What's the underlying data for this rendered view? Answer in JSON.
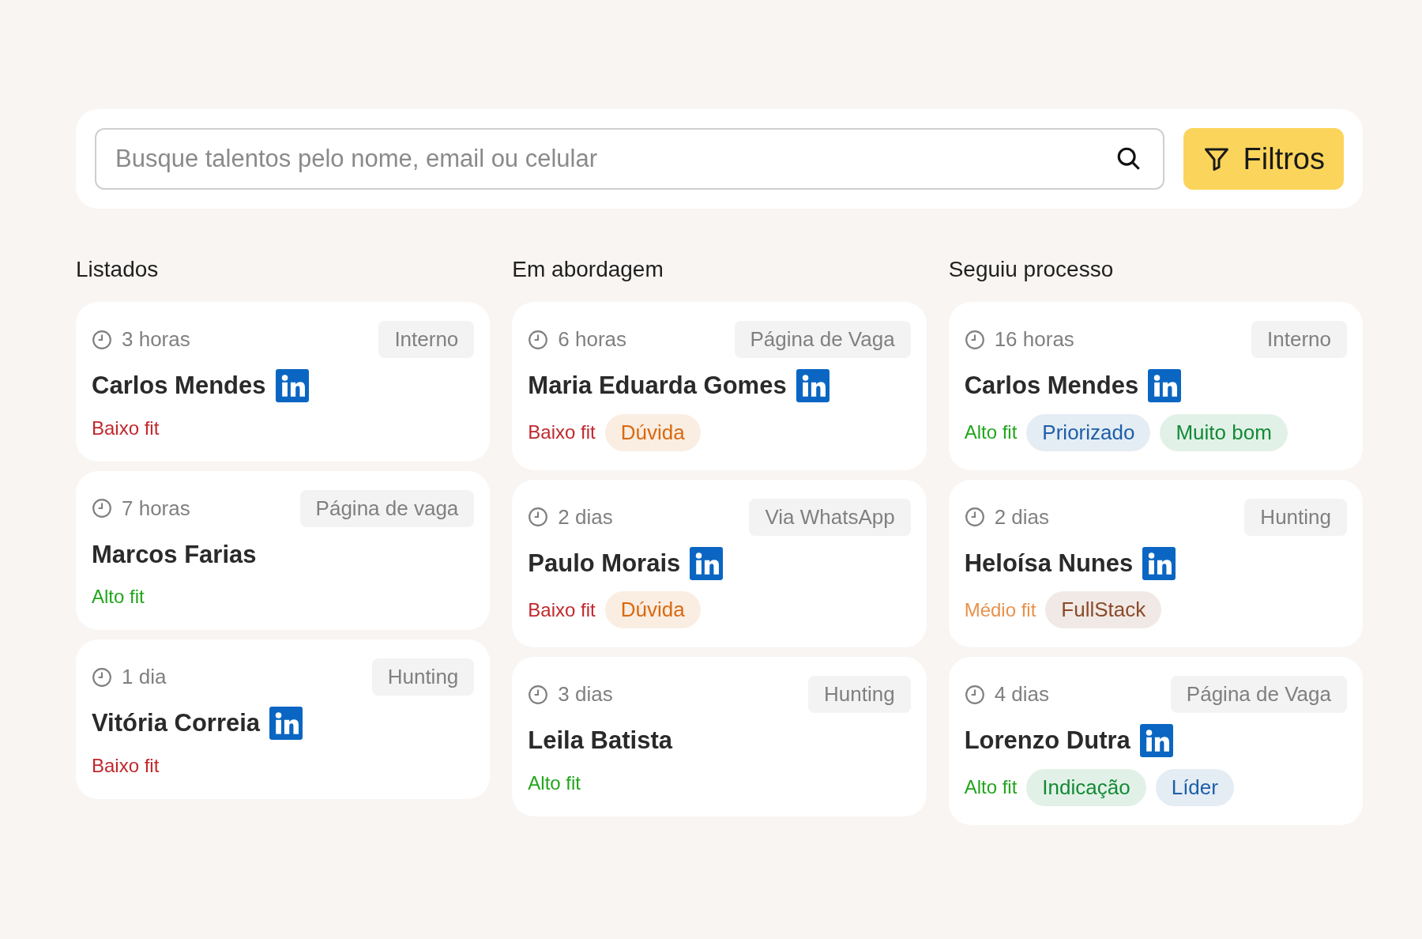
{
  "search": {
    "placeholder": "Busque talentos pelo nome, email ou celular"
  },
  "filter_button": {
    "label": "Filtros"
  },
  "columns": [
    {
      "title": "Listados",
      "cards": [
        {
          "time": "3 horas",
          "source": "Interno",
          "name": "Carlos Mendes",
          "linkedin": true,
          "fit": {
            "label": "Baixo fit",
            "color": "#c0282d"
          }
        },
        {
          "time": "7 horas",
          "source": "Página de vaga",
          "name": "Marcos Farias",
          "linkedin": false,
          "fit": {
            "label": "Alto fit",
            "color": "#22a51c"
          }
        },
        {
          "time": "1 dia",
          "source": "Hunting",
          "name": "Vitória Correia",
          "linkedin": true,
          "fit": {
            "label": "Baixo fit",
            "color": "#c0282d"
          }
        }
      ]
    },
    {
      "title": "Em abordagem",
      "cards": [
        {
          "time": "6 horas",
          "source": "Página de Vaga",
          "name": "Maria Eduarda Gomes",
          "linkedin": true,
          "fit": {
            "label": "Baixo fit",
            "color": "#c0282d"
          },
          "tags": [
            {
              "label": "Dúvida",
              "color": "#d9690f"
            }
          ]
        },
        {
          "time": "2 dias",
          "source": "Via WhatsApp",
          "name": "Paulo Morais",
          "linkedin": true,
          "fit": {
            "label": "Baixo fit",
            "color": "#c0282d"
          },
          "tags": [
            {
              "label": "Dúvida",
              "color": "#d9690f"
            }
          ]
        },
        {
          "time": "3 dias",
          "source": "Hunting",
          "name": "Leila Batista",
          "linkedin": false,
          "fit": {
            "label": "Alto fit",
            "color": "#22a51c"
          }
        }
      ]
    },
    {
      "title": "Seguiu processo",
      "cards": [
        {
          "time": "16 horas",
          "source": "Interno",
          "name": "Carlos Mendes",
          "linkedin": true,
          "fit": {
            "label": "Alto fit",
            "color": "#22a51c"
          },
          "tags": [
            {
              "label": "Priorizado",
              "color": "#1d5fa8"
            },
            {
              "label": "Muito bom",
              "color": "#138a36"
            }
          ]
        },
        {
          "time": "2 dias",
          "source": "Hunting",
          "name": "Heloísa Nunes",
          "linkedin": true,
          "fit": {
            "label": "Médio fit",
            "color": "#e8914a"
          },
          "tags": [
            {
              "label": "FullStack",
              "color": "#8a4a2a"
            }
          ]
        },
        {
          "time": "4 dias",
          "source": "Página de Vaga",
          "name": "Lorenzo Dutra",
          "linkedin": true,
          "fit": {
            "label": "Alto fit",
            "color": "#22a51c"
          },
          "tags": [
            {
              "label": "Indicação",
              "color": "#138a36"
            },
            {
              "label": "Líder",
              "color": "#1d5fa8"
            }
          ]
        }
      ]
    }
  ]
}
